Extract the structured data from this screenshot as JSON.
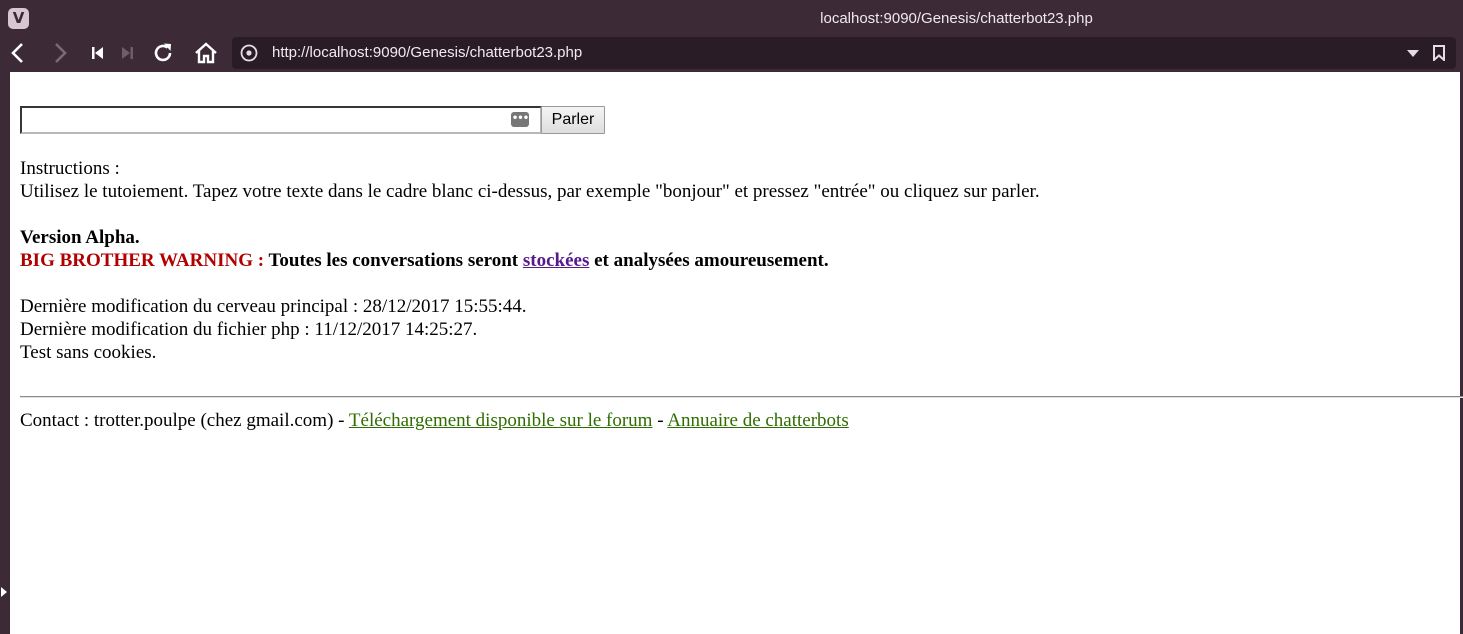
{
  "browser": {
    "window_title": "localhost:9090/Genesis/chatterbot23.php",
    "url": "http://localhost:9090/Genesis/chatterbot23.php",
    "logo": "V",
    "icons": [
      "back-icon",
      "forward-icon",
      "rewind-icon",
      "fast-forward-icon",
      "reload-icon",
      "home-icon",
      "site-info-icon",
      "dropdown-icon",
      "bookmark-icon"
    ]
  },
  "form": {
    "input_value": "",
    "submit_label": "Parler",
    "password_icon": "•••"
  },
  "instructions": {
    "heading": "Instructions :",
    "text": "Utilisez le tutoiement. Tapez votre texte dans le cadre blanc ci-dessus, par exemple \"bonjour\" et pressez \"entrée\" ou cliquez sur parler."
  },
  "version": "Version Alpha.",
  "warning": {
    "label": "BIG BROTHER WARNING :",
    "text_before": "Toutes les conversations seront",
    "link": "stockées",
    "text_after": "et analysées amoureusement."
  },
  "status": {
    "brain_modified": "Dernière modification du cerveau principal : 28/12/2017 15:55:44.",
    "php_modified": "Dernière modification du fichier php : 11/12/2017 14:25:27.",
    "cookies": "Test sans cookies."
  },
  "footer": {
    "contact": "Contact : trotter.poulpe (chez gmail.com) -",
    "download_link": "Téléchargement disponible sur le forum",
    "separator": "-",
    "directory_link": "Annuaire de chatterbots"
  },
  "colors": {
    "chrome": "#3c2a36",
    "warning_red": "#b20000",
    "visited_link": "#551a8b",
    "footer_link": "#2e6d00"
  }
}
